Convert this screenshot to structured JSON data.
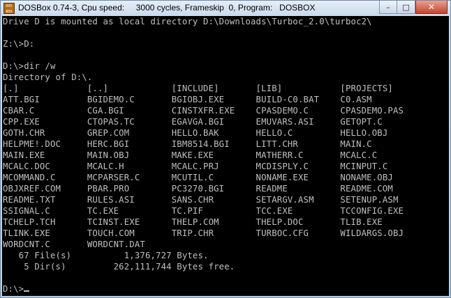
{
  "window": {
    "title": "DOSBox 0.74-3, Cpu speed:     3000 cycles, Frameskip  0, Program:   DOSBOX",
    "icon": "dosbox-icon",
    "controls": {
      "minimize": "–",
      "maximize": "□",
      "close": "✕"
    }
  },
  "colors": {
    "console_bg": "#000000",
    "console_fg": "#c0c0c0",
    "close_button": "#c7442b"
  },
  "console": {
    "lines": [
      "Drive D is mounted as local directory D:\\Downloads\\Turboc_2.0\\turboc2\\",
      "",
      "Z:\\>D:",
      "",
      "D:\\>dir /w",
      "Directory of D:\\.",
      "[.]             [..]            [INCLUDE]       [LIB]           [PROJECTS]",
      "ATT.BGI         BGIDEMO.C       BGIOBJ.EXE      BUILD-C0.BAT    C0.ASM",
      "CBAR.C          CGA.BGI         CINSTXFR.EXE    CPASDEMO.C      CPASDEMO.PAS",
      "CPP.EXE         CTOPAS.TC       EGAVGA.BGI      EMUVARS.ASI     GETOPT.C",
      "GOTH.CHR        GREP.COM        HELLO.BAK       HELLO.C         HELLO.OBJ",
      "HELPME!.DOC     HERC.BGI        IBM8514.BGI     LITT.CHR        MAIN.C",
      "MAIN.EXE        MAIN.OBJ        MAKE.EXE        MATHERR.C       MCALC.C",
      "MCALC.DOC       MCALC.H         MCALC.PRJ       MCDISPLY.C      MCINPUT.C",
      "MCOMMAND.C      MCPARSER.C      MCUTIL.C        NONAME.EXE      NONAME.OBJ",
      "OBJXREF.COM     PBAR.PRO        PC3270.BGI      README          README.COM",
      "README.TXT      RULES.ASI       SANS.CHR        SETARGV.ASM     SETENUP.ASM",
      "SSIGNAL.C       TC.EXE          TC.PIF          TCC.EXE         TCCONFIG.EXE",
      "TCHELP.TCH      TCINST.EXE      THELP.COM       THELP.DOC       TLIB.EXE",
      "TLINK.EXE       TOUCH.COM       TRIP.CHR        TURBOC.CFG      WILDARGS.OBJ",
      "WORDCNT.C       WORDCNT.DAT",
      "   67 File(s)          1,376,727 Bytes.",
      "    5 Dir(s)         262,111,744 Bytes free.",
      ""
    ],
    "prompt": "D:\\>"
  }
}
